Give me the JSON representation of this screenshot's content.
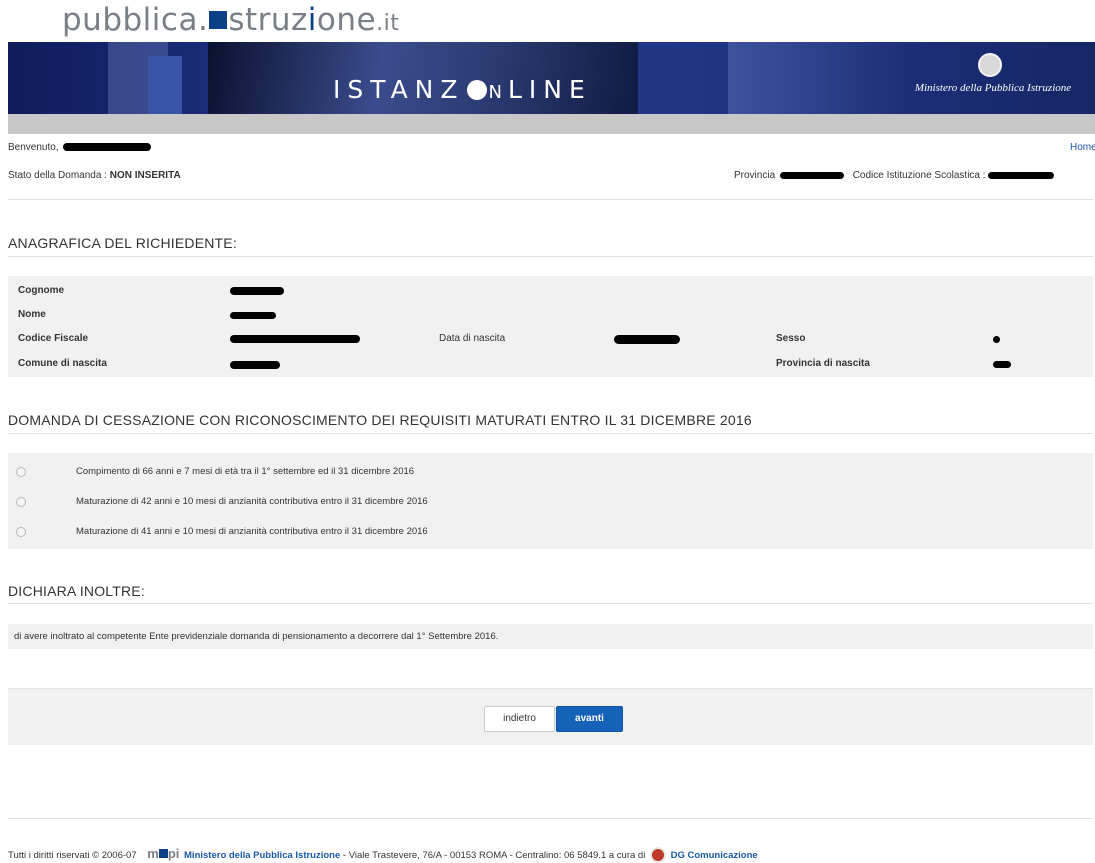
{
  "header": {
    "logo_main": "pubblica.",
    "logo_istr_a": "struz",
    "logo_i2": "i",
    "logo_istr_b": "one",
    "logo_tld": ".it",
    "banner_title_a": "ISTANZ",
    "banner_title_b": "N",
    "banner_title_c": "LINE",
    "ministero": "Ministero della Pubblica Istruzione"
  },
  "info": {
    "welcome_label": "Benvenuto,",
    "home_link": "Home",
    "stato_label": "Stato della Domanda :",
    "stato_value": "NON INSERITA",
    "provincia_label": "Provincia",
    "codice_label": "Codice Istituzione Scolastica :"
  },
  "anagrafica": {
    "title": "ANAGRAFICA DEL RICHIEDENTE:",
    "cognome": "Cognome",
    "nome": "Nome",
    "codice_fiscale": "Codice Fiscale",
    "data_nascita": "Data di nascita",
    "sesso": "Sesso",
    "comune_nascita": "Comune di nascita",
    "provincia_nascita": "Provincia di nascita"
  },
  "domanda": {
    "title": "DOMANDA DI CESSAZIONE CON RICONOSCIMENTO DEI REQUISITI MATURATI ENTRO IL 31 DICEMBRE 2016",
    "options": [
      "Compimento di 66 anni e 7 mesi di età tra il 1° settembre ed il 31 dicembre 2016",
      "Maturazione di 42 anni e 10 mesi di anzianità contributiva entro il 31 dicembre 2016",
      "Maturazione di 41 anni e 10 mesi di anzianità contributiva entro il 31 dicembre 2016"
    ]
  },
  "dichiara": {
    "title": "DICHIARA INOLTRE:",
    "text": "di avere inoltrato al competente Ente previdenziale domanda di pensionamento a decorrere dal 1° Settembre 2016."
  },
  "buttons": {
    "indietro": "indietro",
    "avanti": "avanti"
  },
  "footer": {
    "rights": "Tutti i diritti riservati © 2006-07",
    "mpi_a": "m",
    "mpi_b": "pi",
    "ministero_link": "Ministero della Pubblica Istruzione",
    "address": "- Viale Trastevere, 76/A - 00153 ROMA - Centralino: 06 5849.1  a cura di",
    "dg_link": "DG Comunicazione"
  },
  "colors": {
    "brand_blue": "#0b3f86",
    "button_blue": "#1463b8",
    "panel_grey": "#f1f1f1"
  }
}
